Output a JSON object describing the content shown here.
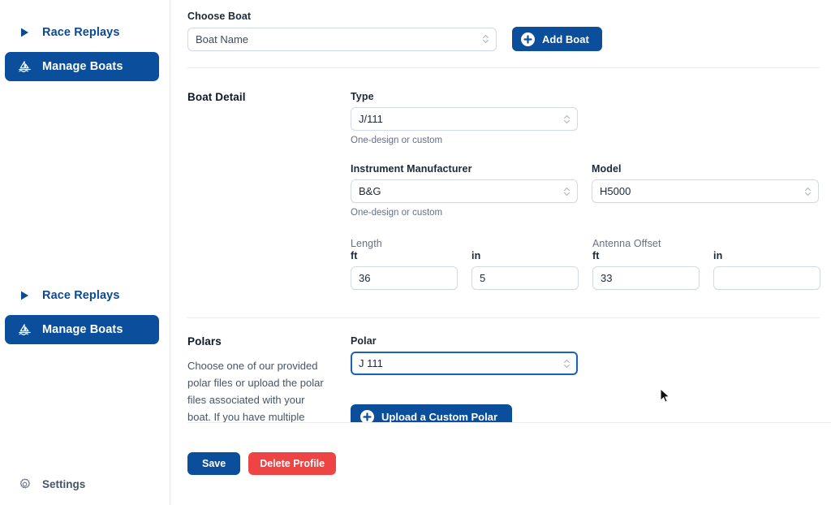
{
  "sidebar": {
    "groups": [
      {
        "items": [
          {
            "label": "Race Replays",
            "icon": "play-triangle-icon",
            "active": false
          },
          {
            "label": "Manage Boats",
            "icon": "sailboat-icon",
            "active": true
          }
        ]
      },
      {
        "items": [
          {
            "label": "Race Replays",
            "icon": "play-triangle-icon",
            "active": false
          },
          {
            "label": "Manage Boats",
            "icon": "sailboat-icon",
            "active": true
          }
        ]
      }
    ],
    "settings": {
      "label": "Settings",
      "icon": "gear-icon"
    }
  },
  "choose_boat": {
    "label": "Choose Boat",
    "select_value": "Boat Name",
    "add_button": "Add Boat"
  },
  "boat_detail": {
    "title": "Boat Detail",
    "type": {
      "label": "Type",
      "value": "J/111",
      "helper": "One-design or custom"
    },
    "manufacturer": {
      "label": "Instrument Manufacturer",
      "value": "B&G",
      "helper": "One-design or custom"
    },
    "model": {
      "label": "Model",
      "value": "H5000"
    },
    "length": {
      "group_label": "Length",
      "ft_label": "ft",
      "ft_value": "36",
      "in_label": "in",
      "in_value": "5"
    },
    "antenna_offset": {
      "group_label": "Antenna Offset",
      "ft_label": "ft",
      "ft_value": "33",
      "in_label": "in",
      "in_value": ""
    }
  },
  "polars": {
    "title": "Polars",
    "description": "Choose one of our provided polar files or upload the polar files associated with your boat. If you have multiple polar files, set the",
    "select_label": "Polar",
    "select_value": "J 111",
    "upload_button": "Upload a Custom Polar"
  },
  "footer": {
    "save_label": "Save",
    "delete_label": "Delete Profile"
  },
  "colors": {
    "brand_blue": "#0b4e9b",
    "link_blue": "#0a4a92",
    "danger_red": "#ef4444",
    "focus_blue": "#1763b5",
    "border": "#d4dae3",
    "muted_text": "#667085"
  }
}
